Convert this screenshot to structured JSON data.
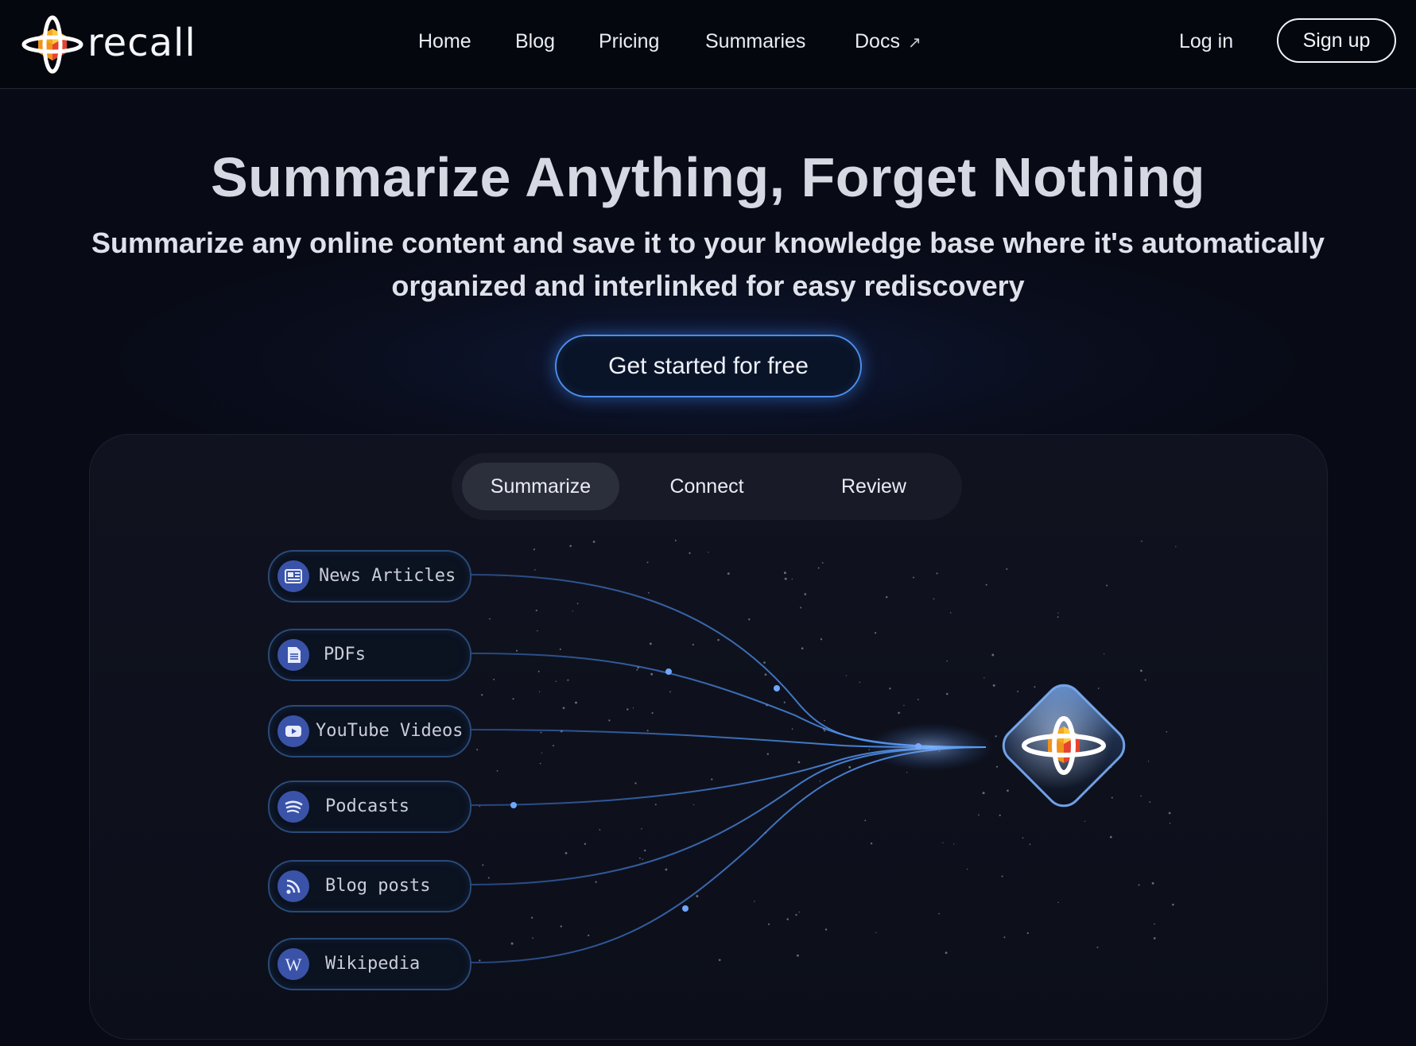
{
  "brand": {
    "name": "recall"
  },
  "nav": {
    "links": [
      "Home",
      "Blog",
      "Pricing",
      "Summaries",
      "Docs"
    ],
    "docs_arrow": "↗",
    "login": "Log in",
    "signup": "Sign up"
  },
  "hero": {
    "title": "Summarize Anything, Forget Nothing",
    "subtitle_line1": "Summarize any online content and save it to your knowledge base where it's automatically",
    "subtitle_line2": "organized and interlinked for easy rediscovery",
    "cta": "Get started for free"
  },
  "tabs": [
    {
      "label": "Summarize",
      "active": true
    },
    {
      "label": "Connect",
      "active": false
    },
    {
      "label": "Review",
      "active": false
    }
  ],
  "sources": [
    {
      "label": "News Articles",
      "icon": "newspaper-icon"
    },
    {
      "label": "PDFs",
      "icon": "document-icon"
    },
    {
      "label": "YouTube Videos",
      "icon": "youtube-icon"
    },
    {
      "label": "Podcasts",
      "icon": "podcast-icon"
    },
    {
      "label": "Blog posts",
      "icon": "rss-icon"
    },
    {
      "label": "Wikipedia",
      "icon": "wikipedia-icon"
    }
  ],
  "colors": {
    "background": "#080b16",
    "accent_blue": "#4c8ee8",
    "logo_orange": "#f5a623",
    "logo_red": "#e5432f"
  }
}
